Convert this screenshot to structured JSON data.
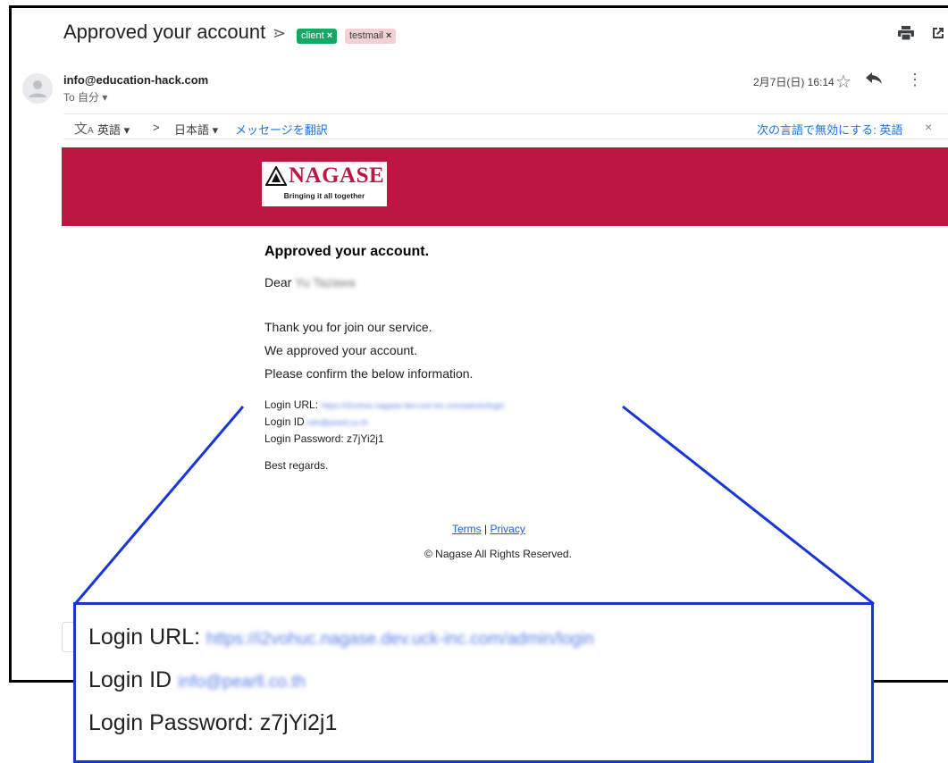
{
  "header": {
    "subject": "Approved your account",
    "importance_icon": "importance-marker-icon",
    "labels": [
      {
        "name": "client",
        "color": "#16a765"
      },
      {
        "name": "testmail",
        "color": "#f2d0d4"
      }
    ],
    "label_remove": "×"
  },
  "message": {
    "sender": "info@education-hack.com",
    "to": "To 自分 ▾",
    "date": "2月7日(日) 16:14"
  },
  "translate_bar": {
    "source_lang": "英語 ▾",
    "arrow": ">",
    "target_lang": "日本語 ▾",
    "translate_link": "メッセージを翻訳",
    "disable_link": "次の言語で無効にする: 英語",
    "close": "×"
  },
  "email": {
    "brand_color": "#be1643",
    "logo_name": "NAGASE",
    "logo_tagline": "Bringing it all together",
    "title": "Approved your account.",
    "greeting_prefix": "Dear",
    "greeting_name_redacted": "Yu Tazawa",
    "lines": [
      "Thank you for join our service.",
      "We approved your account.",
      "Please confirm the below information."
    ],
    "login_url_label": "Login URL:",
    "login_url_redacted": "https://i2vohuc.nagase.dev.uck-inc.com/admin/login",
    "login_id_label": "Login ID",
    "login_id_redacted": "info@pearll.co.th",
    "login_password": "Login Password: z7jYi2j1",
    "sign_off": "Best regards.",
    "footer_terms": "Terms",
    "footer_sep": "|",
    "footer_privacy": "Privacy",
    "copyright": "© Nagase All Rights Reserved."
  },
  "zoom": {
    "highlight_color": "#1836d4"
  }
}
